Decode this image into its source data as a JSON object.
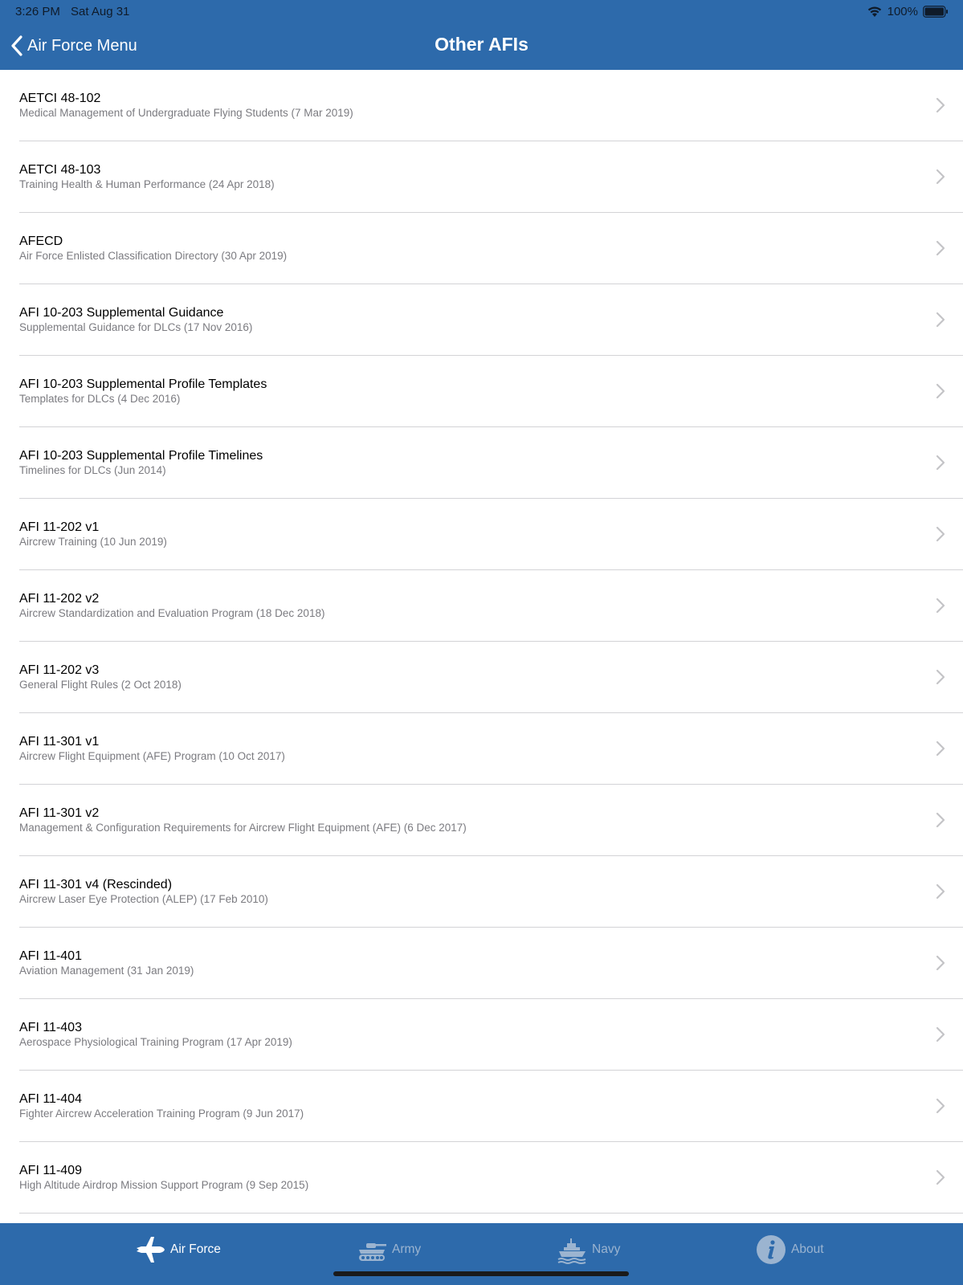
{
  "status_bar": {
    "time": "3:26 PM",
    "date": "Sat Aug 31",
    "battery": "100%"
  },
  "nav": {
    "back_label": "Air Force Menu",
    "title": "Other AFIs"
  },
  "items": [
    {
      "title": "AETCI 48-102",
      "subtitle": "Medical Management of Undergraduate Flying Students (7 Mar 2019)"
    },
    {
      "title": "AETCI 48-103",
      "subtitle": "Training Health & Human Performance (24 Apr 2018)"
    },
    {
      "title": "AFECD",
      "subtitle": "Air Force Enlisted Classification Directory (30 Apr 2019)"
    },
    {
      "title": "AFI 10-203 Supplemental Guidance",
      "subtitle": "Supplemental Guidance for DLCs (17 Nov 2016)"
    },
    {
      "title": "AFI 10-203 Supplemental Profile Templates",
      "subtitle": "Templates for DLCs (4 Dec 2016)"
    },
    {
      "title": "AFI 10-203 Supplemental Profile Timelines",
      "subtitle": "Timelines for DLCs (Jun 2014)"
    },
    {
      "title": "AFI 11-202 v1",
      "subtitle": "Aircrew Training (10 Jun 2019)"
    },
    {
      "title": "AFI 11-202 v2",
      "subtitle": "Aircrew Standardization and Evaluation Program (18 Dec 2018)"
    },
    {
      "title": "AFI 11-202 v3",
      "subtitle": "General Flight Rules (2 Oct 2018)"
    },
    {
      "title": "AFI 11-301 v1",
      "subtitle": "Aircrew Flight Equipment (AFE) Program (10 Oct 2017)"
    },
    {
      "title": "AFI 11-301 v2",
      "subtitle": "Management & Configuration Requirements for Aircrew Flight Equipment (AFE) (6 Dec 2017)"
    },
    {
      "title": "AFI 11-301 v4 (Rescinded)",
      "subtitle": "Aircrew Laser Eye Protection (ALEP) (17 Feb 2010)"
    },
    {
      "title": "AFI 11-401",
      "subtitle": "Aviation Management (31 Jan 2019)"
    },
    {
      "title": "AFI 11-403",
      "subtitle": "Aerospace Physiological Training Program (17 Apr 2019)"
    },
    {
      "title": "AFI 11-404",
      "subtitle": "Fighter Aircrew Acceleration Training Program (9 Jun 2017)"
    },
    {
      "title": "AFI 11-409",
      "subtitle": "High Altitude Airdrop Mission Support Program (9 Sep 2015)"
    }
  ],
  "tabs": [
    {
      "label": "Air Force",
      "icon": "jet-icon",
      "active": true
    },
    {
      "label": "Army",
      "icon": "tank-icon",
      "active": false
    },
    {
      "label": "Navy",
      "icon": "ship-icon",
      "active": false
    },
    {
      "label": "About",
      "icon": "info-icon",
      "active": false
    }
  ],
  "colors": {
    "header_bg": "#2d6aab",
    "tab_active": "#ffffff",
    "tab_inactive": "#9bb4d0",
    "separator": "#d3d3d6"
  }
}
